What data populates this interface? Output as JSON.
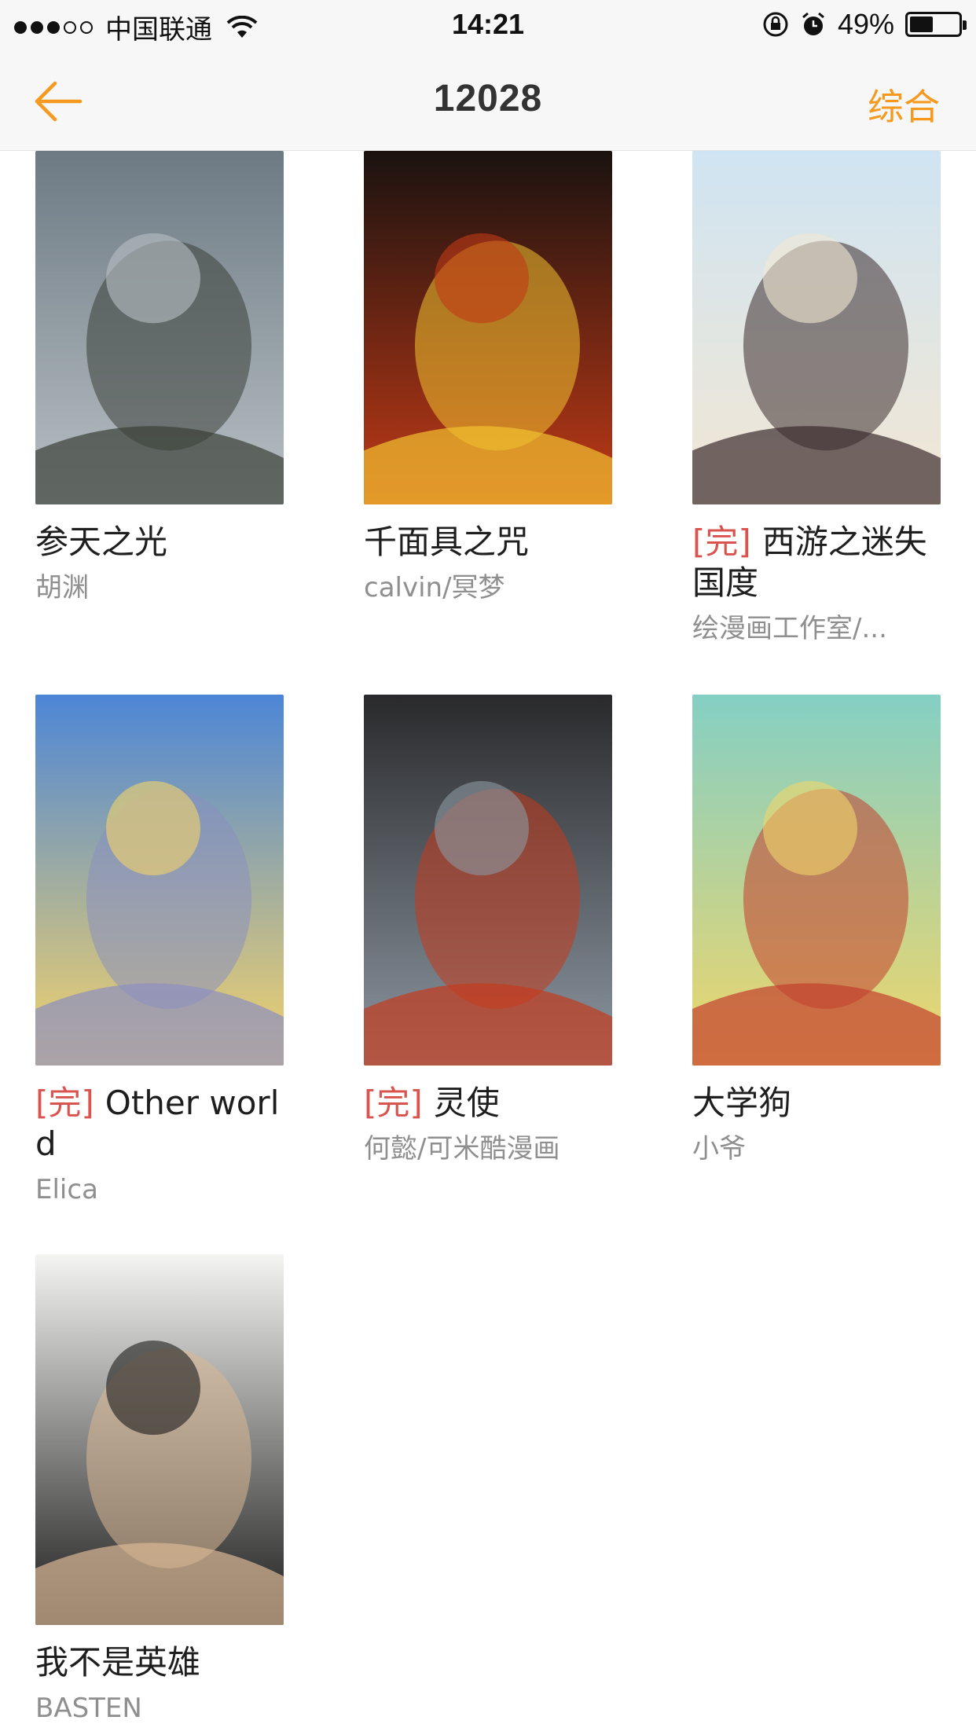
{
  "status_bar": {
    "carrier": "中国联通",
    "time": "14:21",
    "battery_percent": "49%",
    "battery_level": 0.49,
    "signal_bars_filled": 3,
    "signal_bars_total": 5,
    "icons": [
      "wifi-icon",
      "rotation-lock-icon",
      "alarm-icon",
      "battery-icon"
    ]
  },
  "nav": {
    "title": "12028",
    "sort_label": "综合",
    "back_icon": "back-arrow-icon",
    "accent_color": "#f5991f"
  },
  "completed_tag": "[完]",
  "comics": [
    {
      "title": "参天之光",
      "author": "胡渊",
      "completed": false,
      "cover_icon": "comic-cover-image"
    },
    {
      "title": "千面具之咒",
      "author": "calvin/冥梦",
      "completed": false,
      "cover_icon": "comic-cover-image"
    },
    {
      "title": "西游之迷失国度",
      "author": "绘漫画工作室/...",
      "completed": true,
      "cover_icon": "comic-cover-image"
    },
    {
      "title": "Other world",
      "author": "Elica",
      "completed": true,
      "cover_icon": "comic-cover-image"
    },
    {
      "title": "灵使",
      "author": "何懿/可米酷漫画",
      "completed": true,
      "cover_icon": "comic-cover-image"
    },
    {
      "title": "大学狗",
      "author": "小爷",
      "completed": false,
      "cover_icon": "comic-cover-image"
    },
    {
      "title": "我不是英雄",
      "author": "BASTEN",
      "completed": false,
      "cover_icon": "comic-cover-image"
    }
  ]
}
